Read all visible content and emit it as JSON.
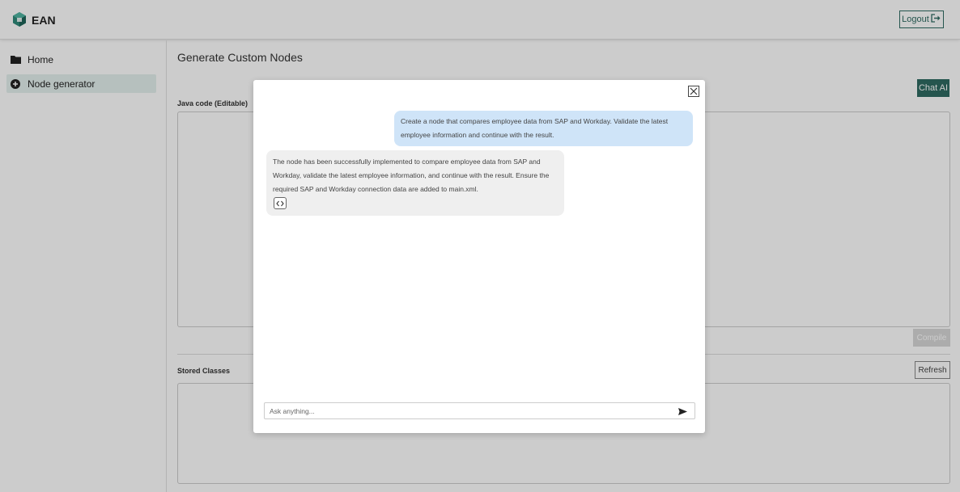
{
  "header": {
    "brand": "EAN",
    "logout_label": "Logout",
    "logo_icon": "cube-logo-icon",
    "logout_icon": "logout-arrow-icon"
  },
  "sidebar": {
    "items": [
      {
        "label": "Home",
        "icon": "folder-icon",
        "active": false
      },
      {
        "label": "Node generator",
        "icon": "plus-circle-icon",
        "active": true
      }
    ]
  },
  "main": {
    "title": "Generate Custom Nodes",
    "chat_ai_label": "Chat AI",
    "java_label": "Java code (Editable)",
    "compile_label": "Compile",
    "stored_label": "Stored Classes",
    "refresh_label": "Refresh"
  },
  "chat": {
    "messages": [
      {
        "role": "user",
        "text": "Create a node that compares employee data from SAP and Workday. Validate the latest employee information and continue with the result."
      },
      {
        "role": "assistant",
        "text": "The node has been successfully implemented to compare employee data from SAP and Workday, validate the latest employee information, and continue with the result. Ensure the required SAP and Workday connection data are added to main.xml."
      }
    ],
    "input_placeholder": "Ask anything..."
  },
  "colors": {
    "accent": "#2f6b62",
    "user_bubble": "#cfe4f8",
    "assistant_bubble": "#efefef",
    "sidebar_active": "#e4f0ee"
  }
}
